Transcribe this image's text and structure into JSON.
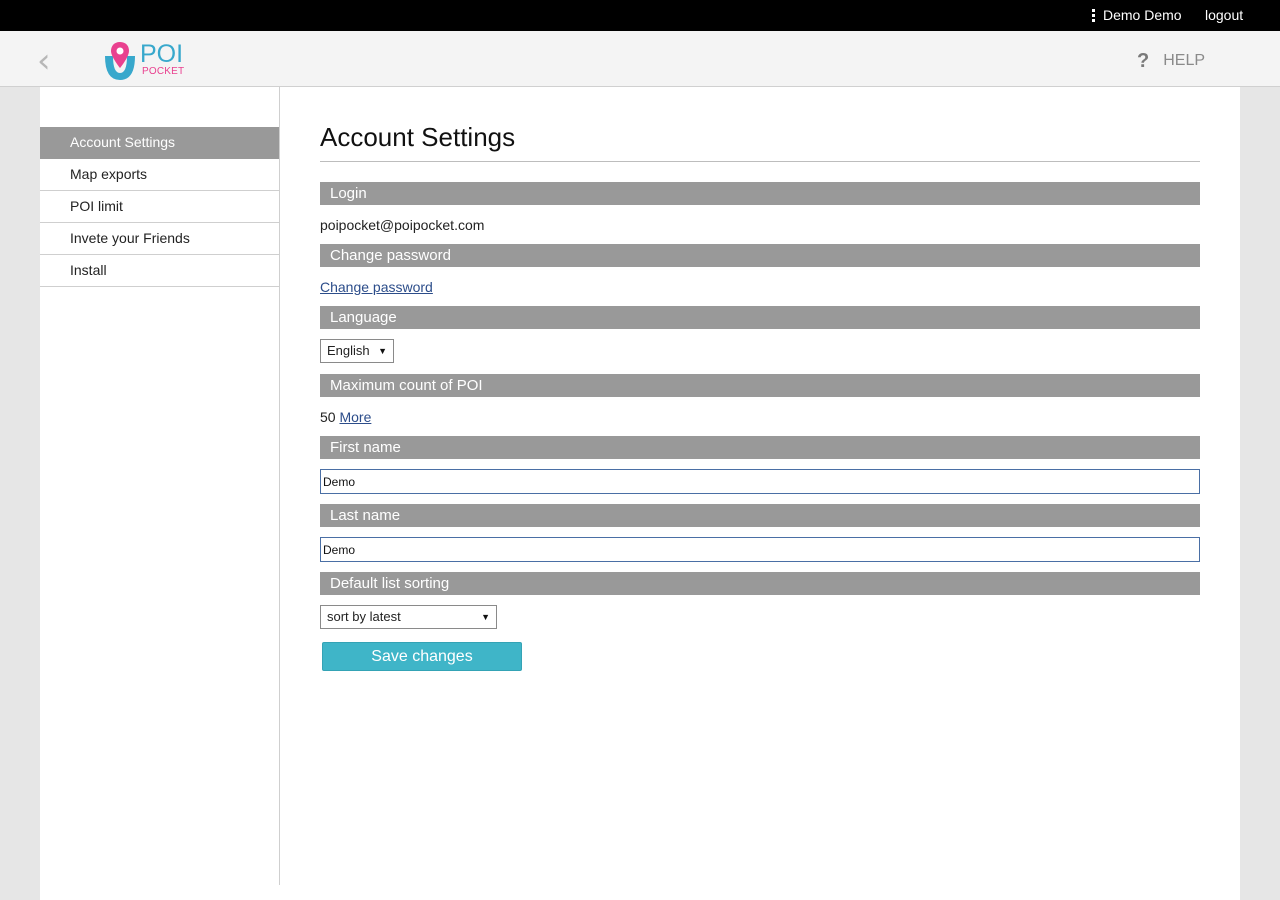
{
  "topbar": {
    "user_name": "Demo Demo",
    "logout_label": "logout"
  },
  "header": {
    "back_icon": "‹",
    "logo": {
      "word": "POI",
      "sub": "POCKET"
    },
    "help_icon": "?",
    "help_label": "HELP"
  },
  "sidebar": {
    "items": [
      {
        "label": "Account Settings",
        "active": true
      },
      {
        "label": "Map exports"
      },
      {
        "label": "POI limit"
      },
      {
        "label": "Invete your Friends"
      },
      {
        "label": "Install"
      }
    ]
  },
  "main": {
    "title": "Account Settings",
    "login": {
      "heading": "Login",
      "value": "poipocket@poipocket.com"
    },
    "password": {
      "heading": "Change password",
      "link": "Change password"
    },
    "language": {
      "heading": "Language",
      "selected": "English"
    },
    "poi_max": {
      "heading": "Maximum count of POI",
      "value": "50",
      "more_link": "More"
    },
    "first_name": {
      "heading": "First name",
      "value": "Demo"
    },
    "last_name": {
      "heading": "Last name",
      "value": "Demo"
    },
    "sorting": {
      "heading": "Default list sorting",
      "selected": "sort by latest"
    },
    "save_label": "Save changes"
  },
  "colors": {
    "accent": "#3fb5c8",
    "section_bar": "#999999",
    "logo_blue": "#38a8cc",
    "logo_pink": "#e9418f"
  }
}
